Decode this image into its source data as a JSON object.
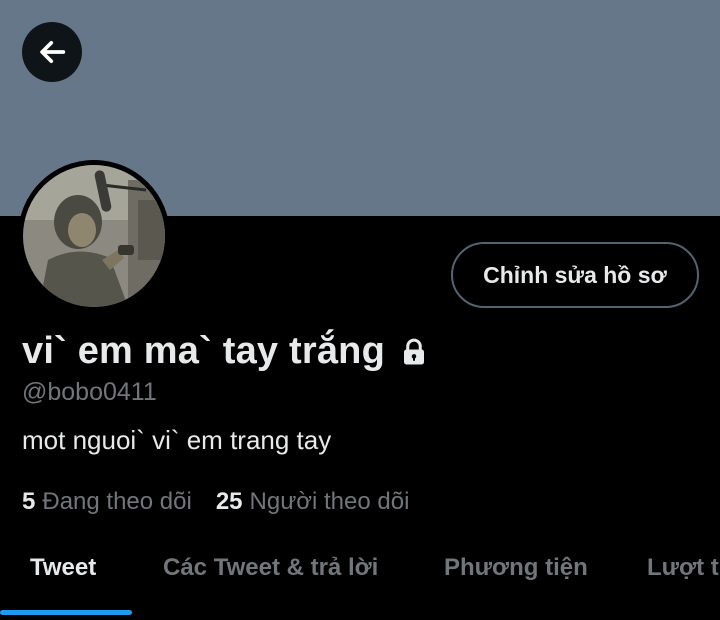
{
  "header": {
    "back_icon": "arrow-left-icon"
  },
  "profile": {
    "display_name": "vi` em ma` tay trắng",
    "lock_icon": "lock-icon",
    "handle": "@bobo0411",
    "bio": "mot nguoi` vi` em trang tay",
    "edit_label": "Chỉnh sửa hồ sơ",
    "following_count": "5",
    "following_label": "Đang theo dõi",
    "followers_count": "25",
    "followers_label": "Người theo dõi"
  },
  "tabs": [
    {
      "label": "Tweet"
    },
    {
      "label": "Các Tweet & trả lời"
    },
    {
      "label": "Phương tiện"
    },
    {
      "label": "Lượt thích"
    }
  ],
  "colors": {
    "banner": "#66778a",
    "accent": "#1d9bf0",
    "text_primary": "#e7e9ea",
    "text_secondary": "#71767b"
  }
}
